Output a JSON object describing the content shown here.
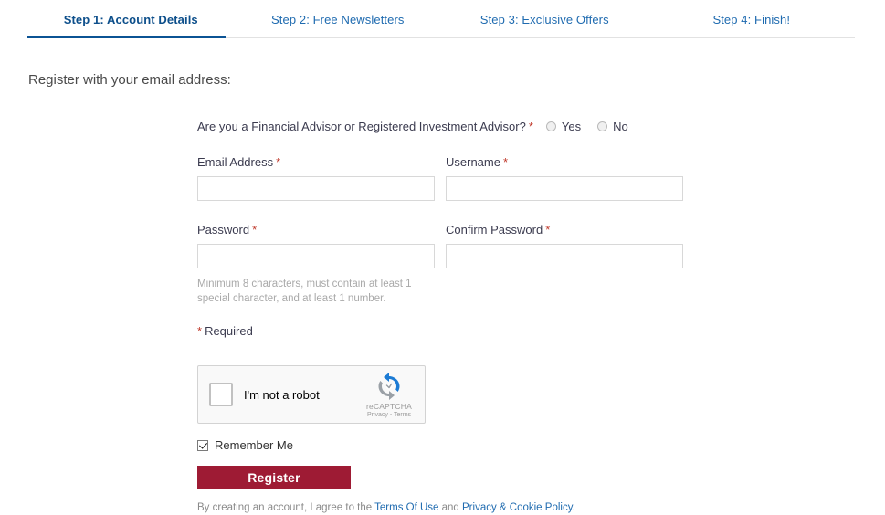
{
  "steps": {
    "tabs": [
      {
        "label": "Step 1: Account Details",
        "active": true
      },
      {
        "label": "Step 2: Free Newsletters",
        "active": false
      },
      {
        "label": "Step 3: Exclusive Offers",
        "active": false
      },
      {
        "label": "Step 4: Finish!",
        "active": false
      }
    ],
    "active_color": "#0d4f8b",
    "inactive_color": "#1f6bb0",
    "underline_color": "#0b5394"
  },
  "intro": {
    "heading": "Register with your email address:"
  },
  "advisor": {
    "question": "Are you a Financial Advisor or Registered Investment Advisor?",
    "required_mark": "*",
    "options": [
      {
        "label": "Yes",
        "selected": false
      },
      {
        "label": "No",
        "selected": false
      }
    ]
  },
  "fields": {
    "email": {
      "label": "Email Address",
      "required_mark": "*",
      "value": "",
      "placeholder": ""
    },
    "username": {
      "label": "Username",
      "required_mark": "*",
      "value": "",
      "placeholder": ""
    },
    "password": {
      "label": "Password",
      "required_mark": "*",
      "value": "",
      "placeholder": ""
    },
    "confirm_password": {
      "label": "Confirm Password",
      "required_mark": "*",
      "value": "",
      "placeholder": ""
    },
    "password_hint": "Minimum 8 characters, must contain at least 1 special character, and at least 1 number."
  },
  "required_note": {
    "star": "*",
    "text": "Required"
  },
  "recaptcha": {
    "label": "I'm not a robot",
    "brand": "reCAPTCHA",
    "links": "Privacy - Terms",
    "checked": false
  },
  "remember": {
    "label": "Remember Me",
    "checked": true
  },
  "submit": {
    "label": "Register",
    "color": "#9e1b34"
  },
  "legal": {
    "prefix": "By creating an account, I agree to the ",
    "terms_link": "Terms Of Use",
    "middle": " and ",
    "privacy_link": "Privacy & Cookie Policy",
    "suffix": ".",
    "link_color": "#1f6bb0"
  }
}
